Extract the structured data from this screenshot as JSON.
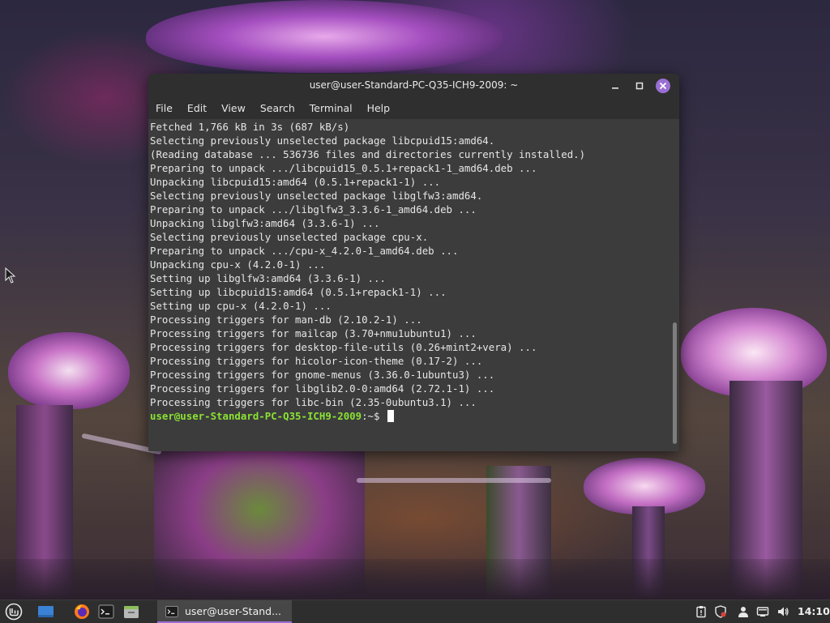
{
  "terminal": {
    "title": "user@user-Standard-PC-Q35-ICH9-2009: ~",
    "menu": [
      "File",
      "Edit",
      "View",
      "Search",
      "Terminal",
      "Help"
    ],
    "lines": [
      "Fetched 1,766 kB in 3s (687 kB/s)",
      "Selecting previously unselected package libcpuid15:amd64.",
      "(Reading database ... 536736 files and directories currently installed.)",
      "Preparing to unpack .../libcpuid15_0.5.1+repack1-1_amd64.deb ...",
      "Unpacking libcpuid15:amd64 (0.5.1+repack1-1) ...",
      "Selecting previously unselected package libglfw3:amd64.",
      "Preparing to unpack .../libglfw3_3.3.6-1_amd64.deb ...",
      "Unpacking libglfw3:amd64 (3.3.6-1) ...",
      "Selecting previously unselected package cpu-x.",
      "Preparing to unpack .../cpu-x_4.2.0-1_amd64.deb ...",
      "Unpacking cpu-x (4.2.0-1) ...",
      "Setting up libglfw3:amd64 (3.3.6-1) ...",
      "Setting up libcpuid15:amd64 (0.5.1+repack1-1) ...",
      "Setting up cpu-x (4.2.0-1) ...",
      "Processing triggers for man-db (2.10.2-1) ...",
      "Processing triggers for mailcap (3.70+nmu1ubuntu1) ...",
      "Processing triggers for desktop-file-utils (0.26+mint2+vera) ...",
      "Processing triggers for hicolor-icon-theme (0.17-2) ...",
      "Processing triggers for gnome-menus (3.36.0-1ubuntu3) ...",
      "Processing triggers for libglib2.0-0:amd64 (2.72.1-1) ...",
      "Processing triggers for libc-bin (2.35-0ubuntu3.1) ..."
    ],
    "prompt_user": "user@user-Standard-PC-Q35-ICH9-2009",
    "prompt_suffix": ":~$ "
  },
  "taskbar": {
    "task_label": "user@user-Stand...",
    "clock": "14:10",
    "launchers": [
      "mint-menu-icon",
      "show-desktop-icon",
      "firefox-icon",
      "terminal-icon",
      "files-icon"
    ],
    "tray": [
      "clipboard-icon",
      "shield-icon",
      "user-icon",
      "network-icon",
      "volume-icon"
    ]
  },
  "colors": {
    "accent": "#9a6fd3",
    "prompt_green": "#8ae234",
    "terminal_bg": "#3c3c3c",
    "titlebar_bg": "#2f2f2f",
    "panel_bg": "#2e2e2e"
  }
}
